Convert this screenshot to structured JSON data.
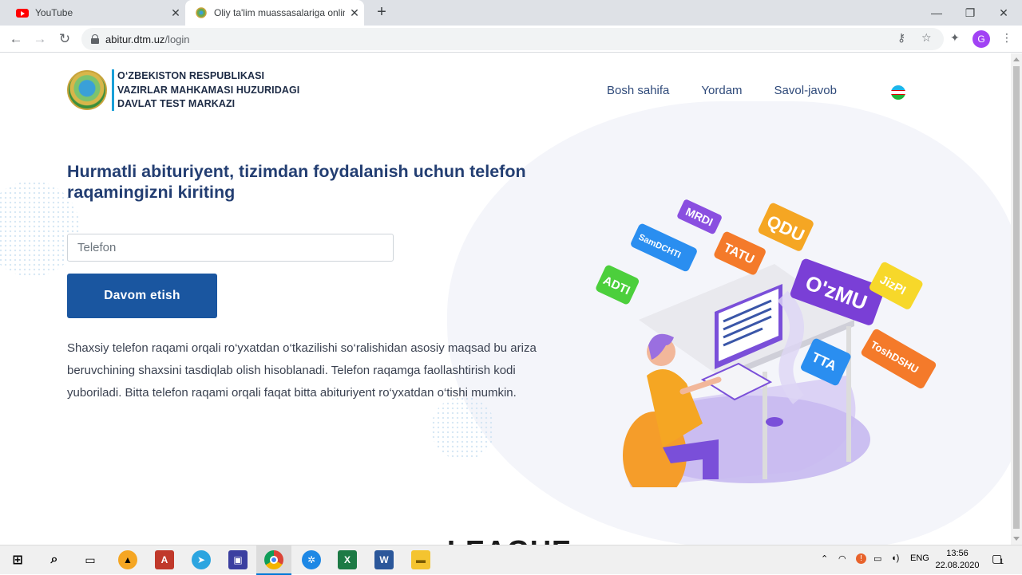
{
  "browser": {
    "tabs": [
      {
        "title": "YouTube",
        "icon": "youtube-icon"
      },
      {
        "title": "Oliy ta'lim muassasalariga online",
        "icon": "emblem-icon"
      }
    ],
    "url_host": "abitur.dtm.uz",
    "url_path": "/login",
    "profile_initial": "G"
  },
  "page": {
    "logo_lines": [
      "O‘ZBEKISTON RESPUBLIKASI",
      "VAZIRLAR MAHKAMASI HUZURIDAGI",
      "DAVLAT TEST MARKAZI"
    ],
    "nav": [
      "Bosh sahifa",
      "Yordam",
      "Savol-javob"
    ],
    "heading": "Hurmatli abituriyent, tizimdan foydalanish uchun telefon raqamingizni kiriting",
    "phone_placeholder": "Telefon",
    "continue_label": "Davom etish",
    "description": "Shaxsiy telefon raqami orqali ro‘yxatdan o‘tkazilishi so‘ralishidan asosiy maqsad bu ariza beruvchining shaxsini tasdiqlab olish hisoblanadi. Telefon raqamga faollashtirish kodi yuboriladi. Bitta telefon raqami orqali faqat bitta abituriyent ro‘yxatdan o‘tishi mumkin.",
    "illustration_tags": [
      "MRDI",
      "QDU",
      "SamDCHTI",
      "TATU",
      "O'zMU",
      "JizPI",
      "ADTI",
      "TTA",
      "ToshDSHU"
    ],
    "background_word": "LEAGUE"
  },
  "taskbar": {
    "lang": "ENG",
    "time": "13:56",
    "date": "22.08.2020",
    "notifications": "1"
  },
  "colors": {
    "primary": "#1a56a0",
    "heading": "#233e72",
    "purple": "#7b3fd6"
  }
}
